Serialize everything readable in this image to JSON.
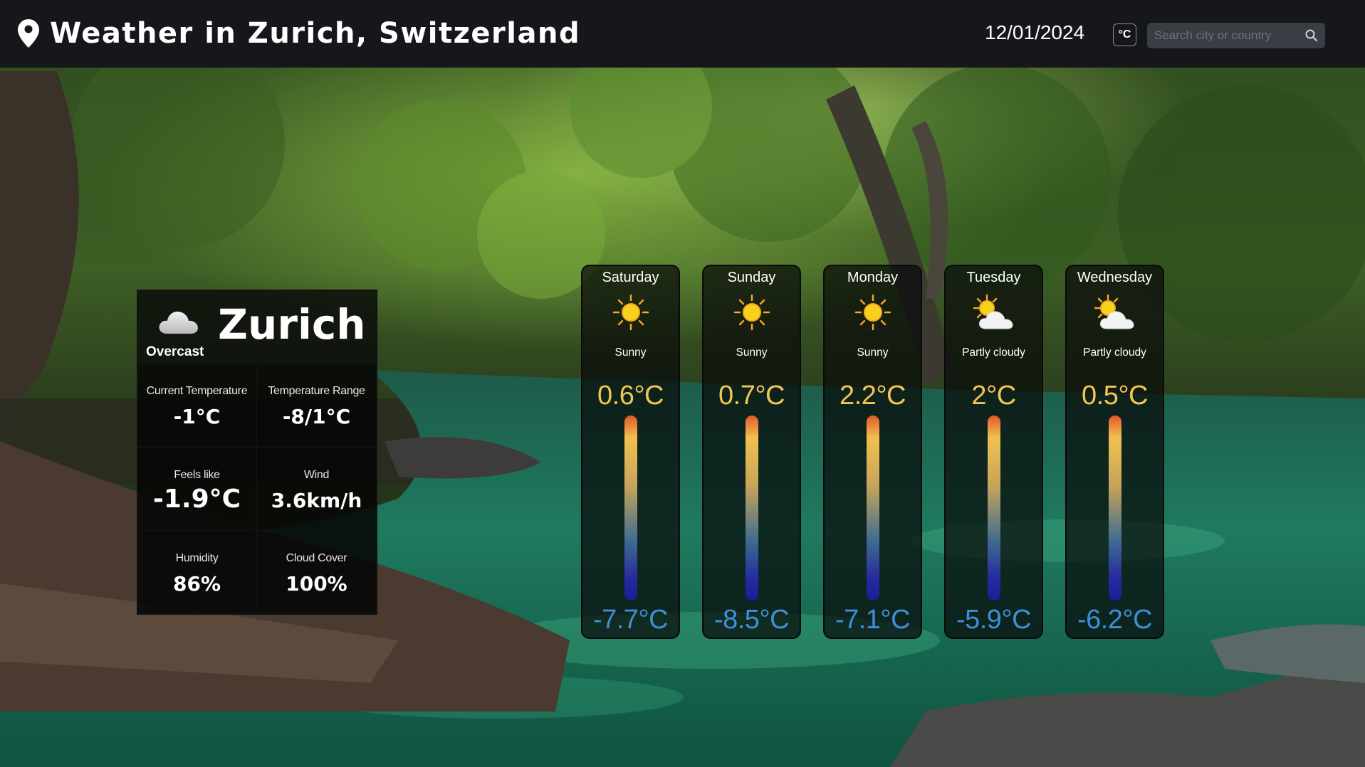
{
  "header": {
    "title": "Weather in Zurich, Switzerland",
    "date": "12/01/2024",
    "unit_toggle_label": "°C",
    "search_placeholder": "Search city or country"
  },
  "current": {
    "city": "Zurich",
    "condition": "Overcast",
    "icon": "cloud-icon",
    "stats": [
      {
        "label": "Current Temperature",
        "value": "-1°C"
      },
      {
        "label": "Temperature Range",
        "value": "-8/1°C"
      },
      {
        "label": "Feels like",
        "value": "-1.9°C"
      },
      {
        "label": "Wind",
        "value": "3.6km/h"
      },
      {
        "label": "Humidity",
        "value": "86%"
      },
      {
        "label": "Cloud Cover",
        "value": "100%"
      }
    ]
  },
  "forecast": [
    {
      "day": "Saturday",
      "condition": "Sunny",
      "icon": "sun-icon",
      "high": "0.6°C",
      "low": "-7.7°C"
    },
    {
      "day": "Sunday",
      "condition": "Sunny",
      "icon": "sun-icon",
      "high": "0.7°C",
      "low": "-8.5°C"
    },
    {
      "day": "Monday",
      "condition": "Sunny",
      "icon": "sun-icon",
      "high": "2.2°C",
      "low": "-7.1°C"
    },
    {
      "day": "Tuesday",
      "condition": "Partly cloudy",
      "icon": "partly-cloudy-icon",
      "high": "2°C",
      "low": "-5.9°C"
    },
    {
      "day": "Wednesday",
      "condition": "Partly cloudy",
      "icon": "partly-cloudy-icon",
      "high": "0.5°C",
      "low": "-6.2°C"
    }
  ],
  "colors": {
    "header_bg": "#15171b",
    "high_temp": "#f2c650",
    "low_temp": "#3f8ed6"
  }
}
